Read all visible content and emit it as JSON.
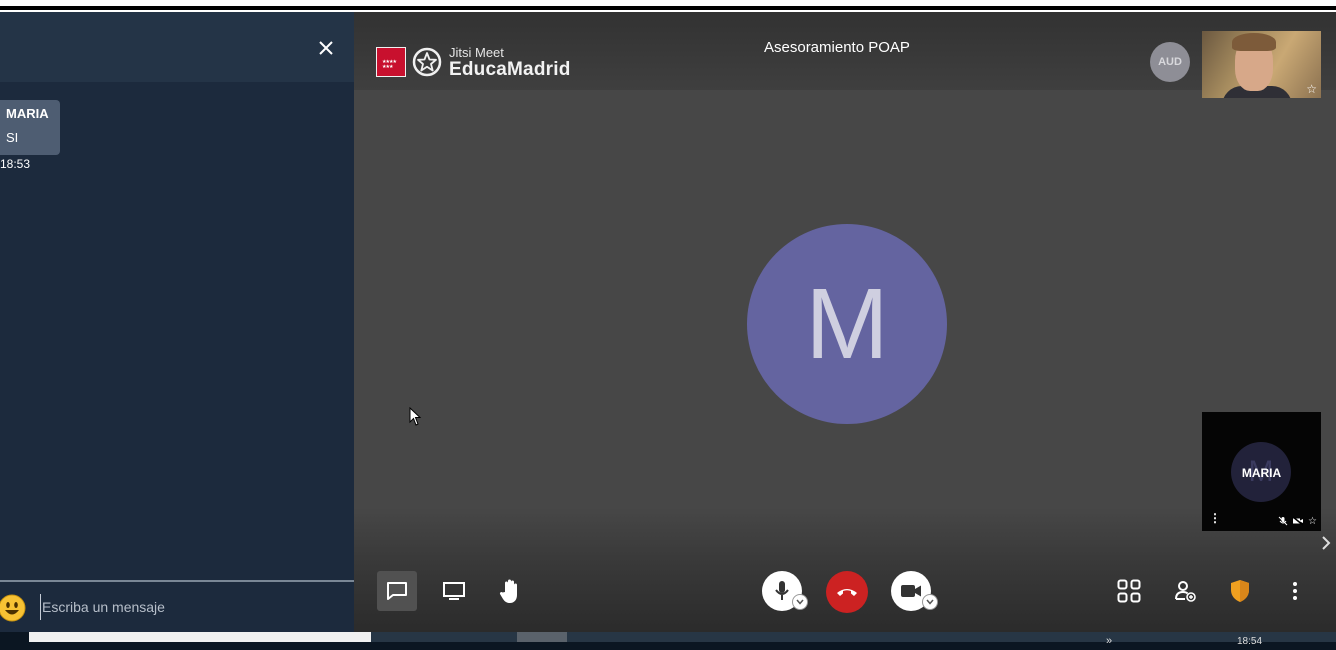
{
  "chat": {
    "close_icon": "close-icon",
    "messages": [
      {
        "sender": "MARIA",
        "text": "SI",
        "time": "18:53"
      }
    ],
    "emoji_icon": "smiley-emoji-icon",
    "input_placeholder": "Escriba un mensaje"
  },
  "header": {
    "logo_small": "Jitsi Meet",
    "logo_big": "EducaMadrid",
    "meeting_title": "Asesoramiento POAP"
  },
  "participants": {
    "aud_avatar": "AUD",
    "main_avatar_letter": "M",
    "maria_thumbnail_name": "MARIA",
    "maria_thumbnail_letter": "M"
  },
  "toolbar": {
    "left": [
      "chat",
      "screen-share",
      "raise-hand"
    ],
    "center": [
      "microphone",
      "hangup",
      "camera"
    ],
    "right": [
      "tile-view",
      "invite",
      "security",
      "more"
    ]
  },
  "taskbar": {
    "clock": "18:54"
  },
  "colors": {
    "chat_bg": "#1c2a3d",
    "stage_bg": "#474747",
    "avatar": "#6464a0",
    "hangup": "#cc2222",
    "security_shield": "#f0a020"
  }
}
